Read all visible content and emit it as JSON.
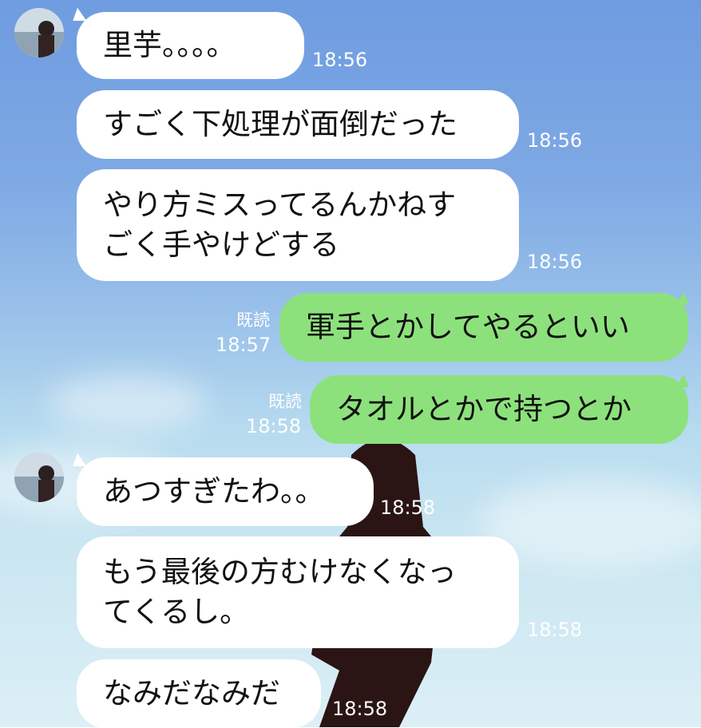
{
  "messages": [
    {
      "side": "in",
      "text": "里芋。。。。",
      "time": "18:56",
      "avatar": true
    },
    {
      "side": "in",
      "text": "すごく下処理が面倒だった",
      "time": "18:56"
    },
    {
      "side": "in",
      "text": "やり方ミスってるんかねす\nごく手やけどする",
      "time": "18:56"
    },
    {
      "side": "out",
      "text": "軍手とかしてやるといい",
      "time": "18:57",
      "read_label": "既読"
    },
    {
      "side": "out",
      "text": "タオルとかで持つとか",
      "time": "18:58",
      "read_label": "既読"
    },
    {
      "side": "in",
      "text": "あつすぎたわ。。",
      "time": "18:58",
      "avatar": true
    },
    {
      "side": "in",
      "text": "もう最後の方むけなくなっ\nてくるし。",
      "time": "18:58"
    },
    {
      "side": "in",
      "text": "なみだなみだ",
      "time": "18:58"
    }
  ],
  "colors": {
    "incoming_bubble": "#ffffff",
    "outgoing_bubble": "#8de17c",
    "meta_text": "#ffffff"
  },
  "icons": {
    "avatar": "contact-avatar-photo"
  }
}
